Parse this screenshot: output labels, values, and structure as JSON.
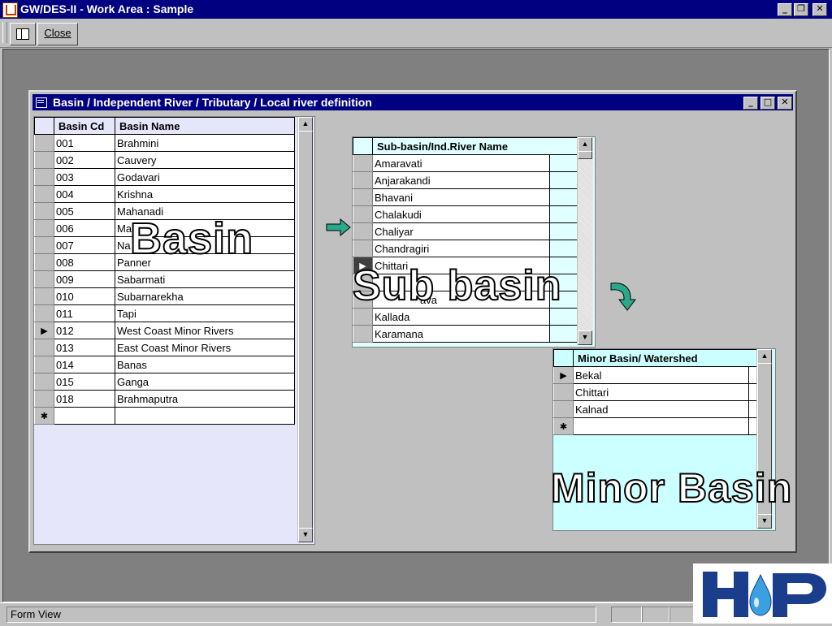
{
  "app": {
    "title": "GW/DES-II - Work Area : Sample"
  },
  "toolbar": {
    "close_label": "Close"
  },
  "form": {
    "title": "Basin / Independent River / Tributary / Local river definition"
  },
  "basin_grid": {
    "headers": [
      "Basin Cd",
      "Basin Name"
    ],
    "rows": [
      {
        "code": "001",
        "name": "Brahmini"
      },
      {
        "code": "002",
        "name": "Cauvery"
      },
      {
        "code": "003",
        "name": "Godavari"
      },
      {
        "code": "004",
        "name": "Krishna"
      },
      {
        "code": "005",
        "name": "Mahanadi"
      },
      {
        "code": "006",
        "name": "Ma"
      },
      {
        "code": "007",
        "name": "Na"
      },
      {
        "code": "008",
        "name": "Panner"
      },
      {
        "code": "009",
        "name": "Sabarmati"
      },
      {
        "code": "010",
        "name": "Subarnarekha"
      },
      {
        "code": "011",
        "name": "Tapi"
      },
      {
        "code": "012",
        "name": "West Coast Minor Rivers"
      },
      {
        "code": "013",
        "name": "East Coast Minor Rivers"
      },
      {
        "code": "014",
        "name": "Banas"
      },
      {
        "code": "015",
        "name": "Ganga"
      },
      {
        "code": "018",
        "name": "Brahmaputra"
      }
    ],
    "current_row": 11
  },
  "subbasin_grid": {
    "header": "Sub-basin/Ind.River Name",
    "rows": [
      "Amaravati",
      "Anjarakandi",
      "Bhavani",
      "Chalakudi",
      "Chaliyar",
      "Chandragiri",
      "Chittari",
      "",
      "",
      "Kallada",
      "Karamana"
    ],
    "current_row": 6,
    "partial_text": "ava"
  },
  "minor_grid": {
    "header": "Minor Basin/ Watershed",
    "rows": [
      "Bekal",
      "Chittari",
      "Kalnad"
    ],
    "current_row": 0
  },
  "overlays": {
    "basin": "Basin",
    "sub_basin": "Sub basin",
    "minor_basin": "Minor Basin"
  },
  "statusbar": {
    "text": "Form View"
  },
  "colors": {
    "titlebar": "#000080",
    "basin_grid_bg": "#e6e6fa",
    "minor_grid_bg": "#ccffff",
    "subbasin_header_bg": "#e0ffff",
    "arrow": "#2aa88a",
    "logo_blue": "#1a3e8c",
    "logo_drop": "#3aa0e0"
  }
}
